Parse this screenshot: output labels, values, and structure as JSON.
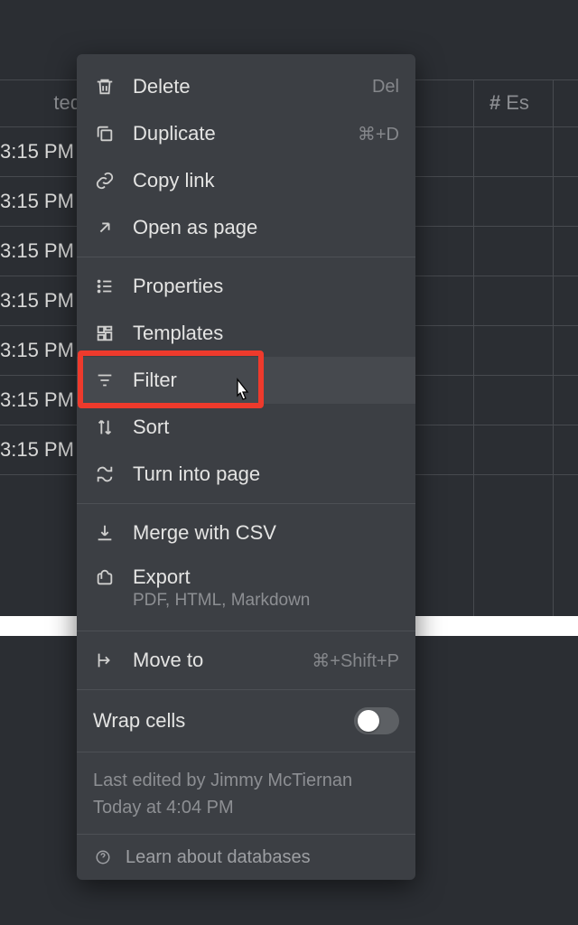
{
  "table": {
    "left_header": "ted",
    "right_header": "Es",
    "row_times": [
      "3:15 PM",
      "3:15 PM",
      "3:15 PM",
      "3:15 PM",
      "3:15 PM",
      "3:15 PM",
      "3:15 PM"
    ]
  },
  "menu": {
    "items": [
      {
        "icon": "trash-icon",
        "label": "Delete",
        "shortcut": "Del"
      },
      {
        "icon": "duplicate-icon",
        "label": "Duplicate",
        "shortcut": "⌘+D"
      },
      {
        "icon": "link-icon",
        "label": "Copy link",
        "shortcut": ""
      },
      {
        "icon": "open-page-icon",
        "label": "Open as page",
        "shortcut": ""
      }
    ],
    "items2": [
      {
        "icon": "properties-icon",
        "label": "Properties",
        "shortcut": ""
      },
      {
        "icon": "templates-icon",
        "label": "Templates",
        "shortcut": ""
      },
      {
        "icon": "filter-icon",
        "label": "Filter",
        "shortcut": ""
      },
      {
        "icon": "sort-icon",
        "label": "Sort",
        "shortcut": ""
      },
      {
        "icon": "turn-into-page-icon",
        "label": "Turn into page",
        "shortcut": ""
      }
    ],
    "items3": [
      {
        "icon": "merge-csv-icon",
        "label": "Merge with CSV",
        "shortcut": ""
      }
    ],
    "export": {
      "icon": "export-icon",
      "label": "Export",
      "sub": "PDF, HTML, Markdown"
    },
    "items4": [
      {
        "icon": "move-to-icon",
        "label": "Move to",
        "shortcut": "⌘+Shift+P"
      }
    ],
    "wrap_label": "Wrap cells",
    "wrap_on": false,
    "edited_by": "Last edited by Jimmy McTiernan",
    "edited_at": "Today at 4:04 PM",
    "learn": "Learn about databases"
  },
  "highlight_target": "filter-menu-item"
}
